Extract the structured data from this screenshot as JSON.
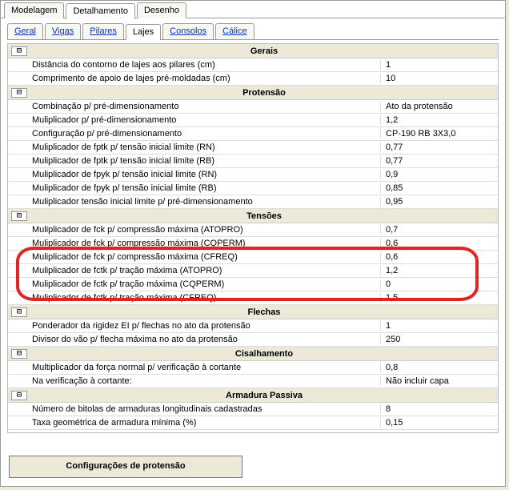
{
  "mainTabs": [
    "Modelagem",
    "Detalhamento",
    "Desenho"
  ],
  "mainActive": 1,
  "subTabs": [
    "Geral",
    "Vigas",
    "Pilares",
    "Lajes",
    "Consolos",
    "Cálice"
  ],
  "subActive": 3,
  "sections": {
    "gerais": {
      "title": "Gerais",
      "rows": [
        {
          "label": "Distância do contorno de lajes aos pilares (cm)",
          "value": "1"
        },
        {
          "label": "Comprimento de apoio de lajes pré-moldadas (cm)",
          "value": "10"
        }
      ]
    },
    "protensao": {
      "title": "Protensão",
      "rows": [
        {
          "label": "Combinação p/ pré-dimensionamento",
          "value": "Ato da protensão"
        },
        {
          "label": "Muliplicador p/ pré-dimensionamento",
          "value": "1,2"
        },
        {
          "label": "Configuração p/ pré-dimensionamento",
          "value": "CP-190 RB 3X3,0"
        },
        {
          "label": "Muliplicador de fptk p/ tensão inicial limite (RN)",
          "value": "0,77"
        },
        {
          "label": "Muliplicador de fptk p/ tensão inicial limite (RB)",
          "value": "0,77"
        },
        {
          "label": "Muliplicador de fpyk p/ tensão inicial limite (RN)",
          "value": "0,9"
        },
        {
          "label": "Muliplicador de fpyk p/ tensão inicial limite (RB)",
          "value": "0,85"
        },
        {
          "label": "Muliplicador tensão inicial limite p/ pré-dimensionamento",
          "value": "0,95"
        }
      ]
    },
    "tensoes": {
      "title": "Tensões",
      "rows": [
        {
          "label": "Muliplicador de fck p/ compressão máxima (ATOPRO)",
          "value": "0,7"
        },
        {
          "label": "Muliplicador de fck p/ compressão máxima (CQPERM)",
          "value": "0,6"
        },
        {
          "label": "Muliplicador de fck p/ compressão máxima (CFREQ)",
          "value": "0,6"
        },
        {
          "label": "Muliplicador de fctk p/ tração máxima (ATOPRO)",
          "value": "1,2"
        },
        {
          "label": "Muliplicador de fctk p/ tração máxima (CQPERM)",
          "value": "0"
        },
        {
          "label": "Muliplicador de fctk p/ tração máxima (CFREQ)",
          "value": "1,5"
        }
      ]
    },
    "flechas": {
      "title": "Flechas",
      "rows": [
        {
          "label": "Ponderador da rigidez EI p/ flechas no ato da protensão",
          "value": "1"
        },
        {
          "label": "Divisor do vão p/ flecha máxima no ato da protensão",
          "value": "250"
        }
      ]
    },
    "cisalhamento": {
      "title": "Cisalhamento",
      "rows": [
        {
          "label": "Multiplicador da força normal p/ verificação à cortante",
          "value": "0,8"
        },
        {
          "label": "Na verificação à cortante:",
          "value": "Não incluir capa"
        }
      ]
    },
    "armadura": {
      "title": "Armadura Passiva",
      "rows": [
        {
          "label": "Número de bitolas de armaduras longitudinais cadastradas",
          "value": "8"
        },
        {
          "label": "Taxa geométrica de armadura mínima (%)",
          "value": "0,15"
        }
      ]
    }
  },
  "expander_glyph": "⊟",
  "button": "Configurações de protensão"
}
